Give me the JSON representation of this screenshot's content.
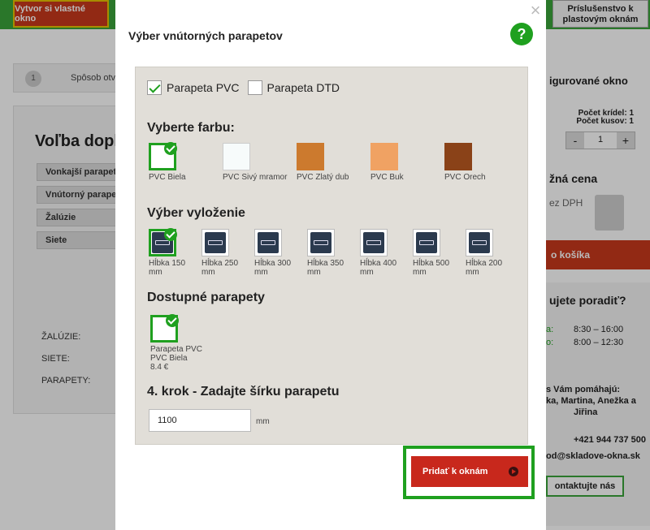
{
  "background": {
    "top_left_button": "Vytvor si vlastné okno",
    "top_right_button": "Príslušenstvo k plastovým oknám",
    "step_number": "1",
    "step_label": "Spôsob otv",
    "left_title": "Voľba dopl",
    "accordion": [
      "Vonkajší parapet",
      "Vnútorný parapet",
      "Žalúzie",
      "Siete"
    ],
    "summary": [
      "ŽALÚZIE:",
      "SIETE:",
      "PARAPETY:"
    ],
    "right_title": "igurované okno",
    "pocet_kridel": "Počet krídel: 1",
    "pocet_kusov": "Počet kusov: 1",
    "qty_minus": "-",
    "qty_value": "1",
    "qty_plus": "+",
    "price_title": "žná cena",
    "dph": "ez DPH",
    "cart_button": "o košíka",
    "advice_title": "ujete poradiť?",
    "hours": [
      {
        "label": "a:",
        "time": "8:30 – 16:00"
      },
      {
        "label": "o:",
        "time": "8:00 – 12:30"
      }
    ],
    "helpers_1": "s Vám pomáhajú:",
    "helpers_2": "ka, Martina, Anežka a",
    "helpers_3": "Jiřina",
    "phone": "+421 944 737 500",
    "email": "od@skladove-okna.sk",
    "contact_button": "ontaktujte nás"
  },
  "modal": {
    "title": "Výber vnútorných parapetov",
    "help": "?",
    "close": "×",
    "checkboxes": [
      {
        "label": "Parapeta PVC",
        "checked": true
      },
      {
        "label": "Parapeta DTD",
        "checked": false
      }
    ],
    "color_section_title": "Vyberte farbu:",
    "colors": [
      {
        "label": "PVC Biela",
        "hex": "#ffffff",
        "selected": true
      },
      {
        "label": "PVC Sivý mramor",
        "hex": "#f7fbfb",
        "selected": false
      },
      {
        "label": "PVC Zlatý dub",
        "hex": "#cc7a2e",
        "selected": false
      },
      {
        "label": "PVC Buk",
        "hex": "#f0a263",
        "selected": false
      },
      {
        "label": "PVC Orech",
        "hex": "#8a4218",
        "selected": false
      }
    ],
    "depth_section_title": "Výber vyloženie",
    "depths": [
      {
        "label": "Hĺbka 150 mm",
        "selected": true
      },
      {
        "label": "Hĺbka 250 mm",
        "selected": false
      },
      {
        "label": "Hĺbka 300 mm",
        "selected": false
      },
      {
        "label": "Hĺbka 350 mm",
        "selected": false
      },
      {
        "label": "Hĺbka 400 mm",
        "selected": false
      },
      {
        "label": "Hĺbka 500 mm",
        "selected": false
      },
      {
        "label": "Hĺbka 200 mm",
        "selected": false
      }
    ],
    "available_title": "Dostupné parapety",
    "available_line1": "Parapeta PVC",
    "available_line2": "PVC Biela",
    "available_price": "8.4 €",
    "width_title": "4. krok - Zadajte šírku parapetu",
    "width_value": "1100",
    "width_unit": "mm",
    "add_button": "Pridať k oknám"
  },
  "colors": {
    "accent_green": "#1fa01f",
    "button_red": "#c8281c"
  }
}
